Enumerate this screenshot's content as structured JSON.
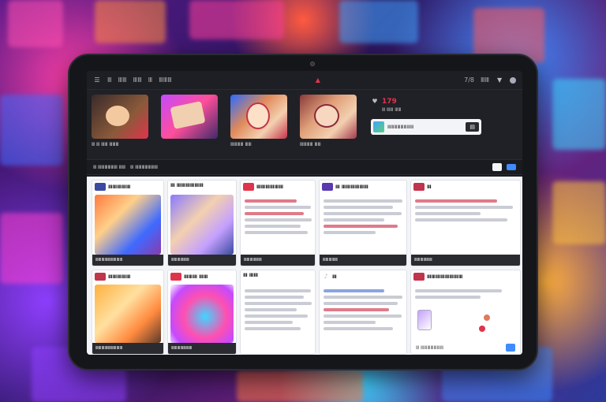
{
  "topbar": {
    "left_labels": [
      "☰",
      "Ⅲ",
      "ⅢⅢ",
      "ⅢⅢ",
      "Ⅲ",
      "ⅢⅢⅢ"
    ],
    "right_labels": [
      "7/8",
      "ⅢⅢ"
    ]
  },
  "dark_row": {
    "cards": [
      {
        "caption": "Ⅲ Ⅲ ⅢⅢ ⅢⅢⅢ"
      },
      {
        "caption": ""
      },
      {
        "caption": "ⅢⅢⅢⅢ   ⅢⅢ"
      },
      {
        "caption": "ⅢⅢⅢⅢ   ⅢⅢ"
      }
    ],
    "stat_value": "179",
    "stat_sub": "Ⅲ ⅢⅢ ⅢⅢ",
    "promo_text": "ⅢⅢⅢⅢⅢⅢⅢⅢ",
    "promo_button": "▤"
  },
  "subbar": {
    "items": [
      "Ⅲ ⅢⅢⅢⅢⅢⅢ ⅢⅢ",
      "Ⅲ ⅢⅢⅢⅢⅢⅢⅢ"
    ]
  },
  "grid": {
    "row1": [
      {
        "title": "ⅢⅢⅢⅢⅢ",
        "footer": "ⅢⅢⅢⅢⅢⅢⅢⅢⅢ"
      },
      {
        "title": "Ⅲ ⅢⅢⅢⅢⅢⅢ",
        "footer": "ⅢⅢⅢⅢⅢⅢ"
      },
      {
        "title": "ⅢⅢⅢⅢⅢⅢ",
        "footer": "ⅢⅢⅢⅢⅢⅢ"
      },
      {
        "title": "Ⅲ ⅢⅢⅢⅢⅢⅢ",
        "footer": "ⅢⅢⅢⅢⅢ"
      },
      {
        "title": "Ⅲ",
        "footer": "ⅢⅢⅢⅢⅢⅢ"
      }
    ],
    "row2": [
      {
        "title": "ⅢⅢⅢⅢⅢ",
        "footer": "ⅢⅢⅢⅢⅢⅢⅢⅢⅢ"
      },
      {
        "title": "ⅢⅢⅢ ⅢⅢ",
        "footer": "ⅢⅢⅢⅢⅢⅢⅢ"
      },
      {
        "title": "Ⅲ ⅢⅢ",
        "footer": ""
      },
      {
        "title": "Ⅲ",
        "footer": ""
      },
      {
        "title": "ⅢⅢⅢⅢⅢⅢⅢⅢ",
        "footer": "Ⅲ ⅢⅢⅢⅢⅢⅢⅢ"
      }
    ]
  },
  "colors": {
    "accent_red": "#e0344c",
    "accent_blue": "#3f8cff",
    "dark_bg": "#1b1c21"
  }
}
